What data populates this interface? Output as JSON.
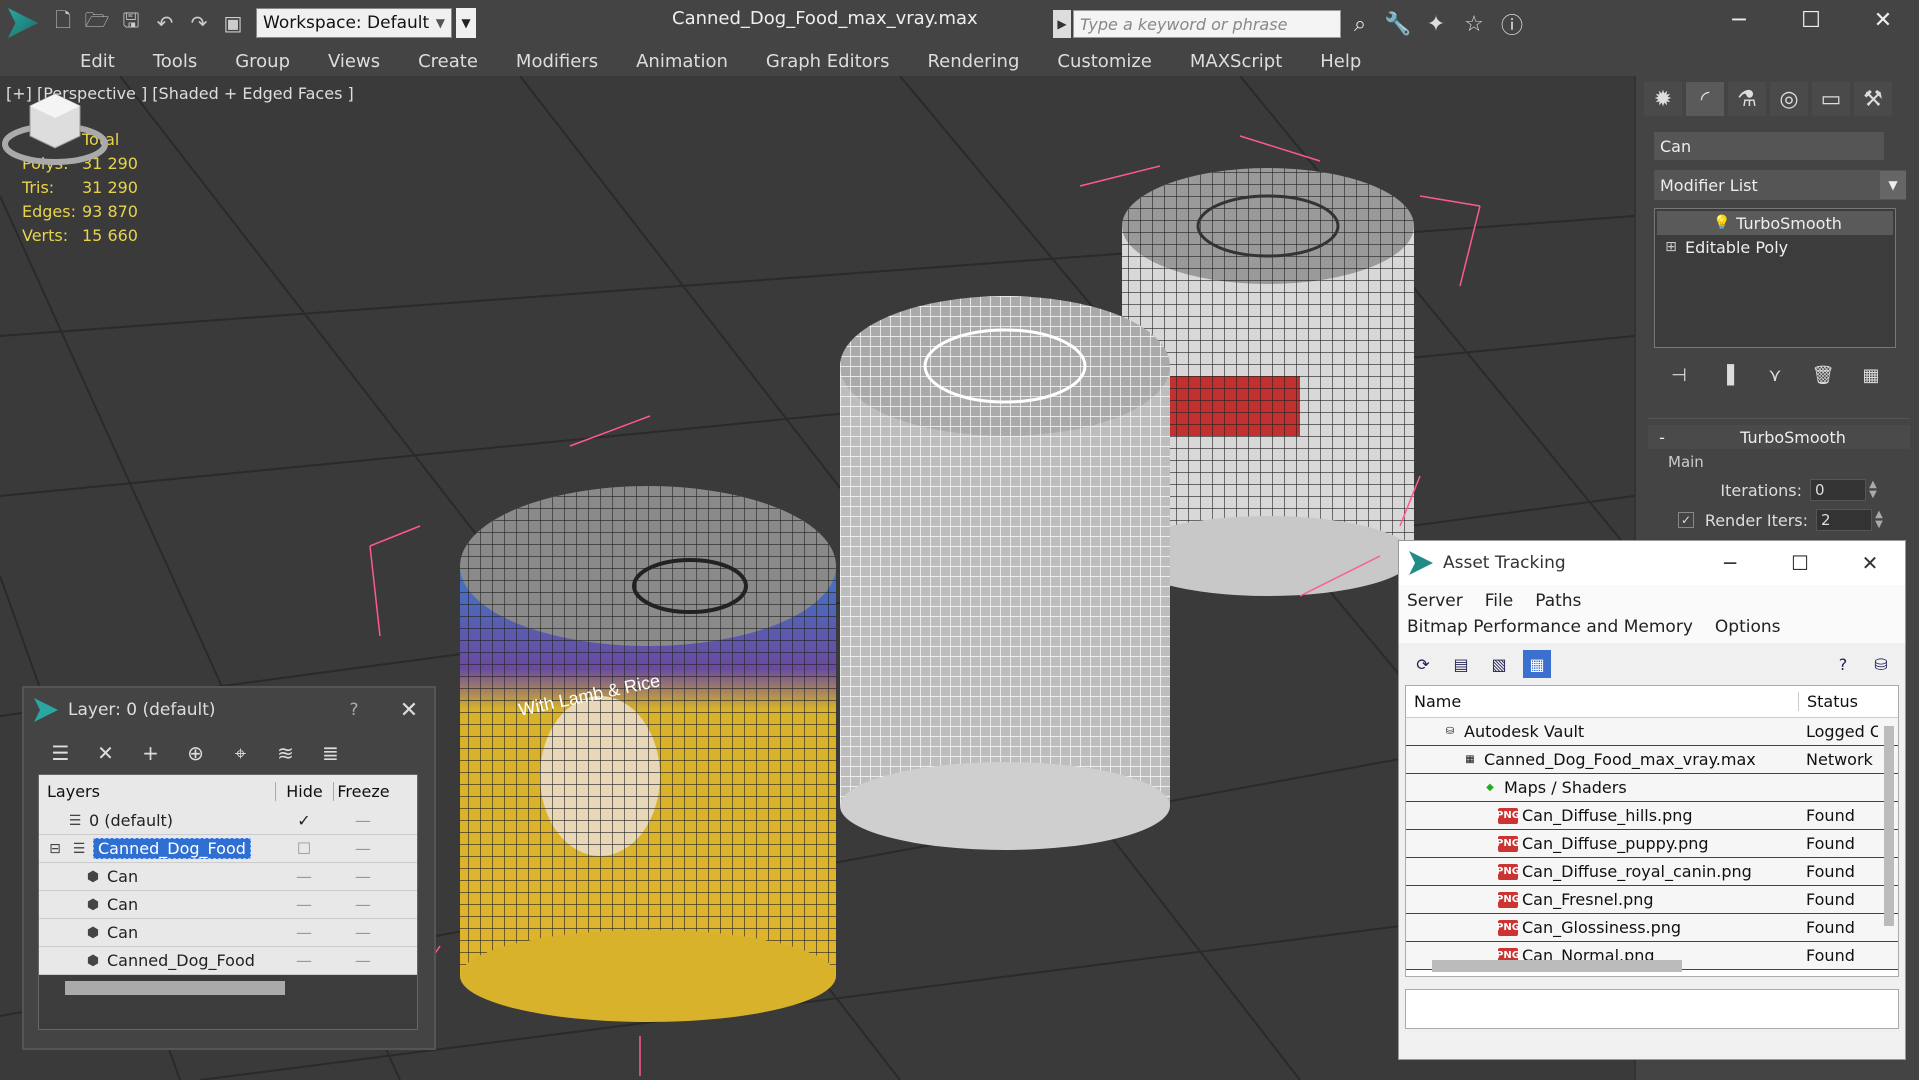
{
  "app": {
    "workspace_label": "Workspace: Default",
    "doc_title": "Canned_Dog_Food_max_vray.max",
    "search_placeholder": "Type a keyword or phrase"
  },
  "menu": [
    "Edit",
    "Tools",
    "Group",
    "Views",
    "Create",
    "Modifiers",
    "Animation",
    "Graph Editors",
    "Rendering",
    "Customize",
    "MAXScript",
    "Help"
  ],
  "viewport": {
    "label": "[+] [Perspective ] [Shaded + Edged Faces ]",
    "stats": {
      "header": "Total",
      "rows": [
        {
          "k": "Polys:",
          "v": "31 290"
        },
        {
          "k": "Tris:",
          "v": "31 290"
        },
        {
          "k": "Edges:",
          "v": "93 870"
        },
        {
          "k": "Verts:",
          "v": "15 660"
        }
      ]
    },
    "can_label_text": "With Lamb & Rice"
  },
  "command_panel": {
    "object_name": "Can",
    "modifier_list": "Modifier List",
    "stack": [
      "TurboSmooth",
      "Editable Poly"
    ],
    "rollout_title": "TurboSmooth",
    "group": "Main",
    "iterations_label": "Iterations:",
    "iterations_value": "0",
    "render_iters_label": "Render Iters:",
    "render_iters_value": "2"
  },
  "layer_window": {
    "title": "Layer: 0 (default)",
    "help": "?",
    "columns": [
      "Layers",
      "Hide",
      "Freeze"
    ],
    "rows": [
      {
        "name": "0 (default)",
        "indent": 0
      },
      {
        "name": "Canned_Dog_Food",
        "indent": 0
      },
      {
        "name": "Can",
        "indent": 1
      },
      {
        "name": "Can",
        "indent": 1
      },
      {
        "name": "Can",
        "indent": 1
      },
      {
        "name": "Canned_Dog_Food",
        "indent": 1
      }
    ]
  },
  "asset_window": {
    "title": "Asset Tracking",
    "menu": [
      "Server",
      "File",
      "Paths",
      "Bitmap Performance and Memory",
      "Options"
    ],
    "columns": [
      "Name",
      "Status"
    ],
    "rows": [
      {
        "name": "Autodesk Vault",
        "status": "Logged O",
        "indent": 1
      },
      {
        "name": "Canned_Dog_Food_max_vray.max",
        "status": "Network",
        "indent": 2
      },
      {
        "name": "Maps / Shaders",
        "status": "",
        "indent": 3
      },
      {
        "name": "Can_Diffuse_hills.png",
        "status": "Found",
        "indent": 4
      },
      {
        "name": "Can_Diffuse_puppy.png",
        "status": "Found",
        "indent": 4
      },
      {
        "name": "Can_Diffuse_royal_canin.png",
        "status": "Found",
        "indent": 4
      },
      {
        "name": "Can_Fresnel.png",
        "status": "Found",
        "indent": 4
      },
      {
        "name": "Can_Glossiness.png",
        "status": "Found",
        "indent": 4
      },
      {
        "name": "Can_Normal.png",
        "status": "Found",
        "indent": 4
      }
    ]
  }
}
